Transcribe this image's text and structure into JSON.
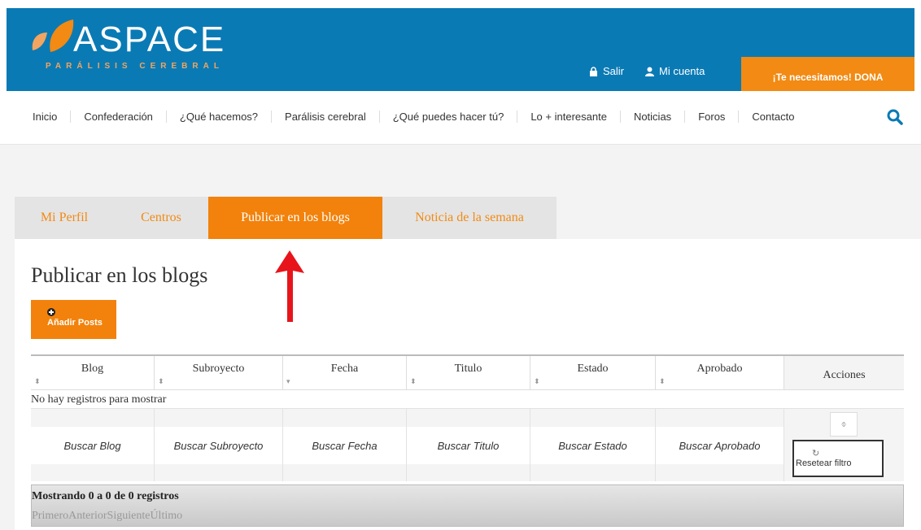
{
  "header": {
    "logo_text": "ASPACE",
    "logo_sub": "PARÁLISIS CEREBRAL",
    "salir_label": "Salir",
    "cuenta_label": "Mi cuenta",
    "donate_label": "¡Te necesitamos! DONA"
  },
  "nav": {
    "items": [
      "Inicio",
      "Confederación",
      "¿Qué hacemos?",
      "Parálisis cerebral",
      "¿Qué puedes hacer tú?",
      "Lo + interesante",
      "Noticias",
      "Foros",
      "Contacto"
    ]
  },
  "tabs": [
    "Mi Perfil",
    "Centros",
    "Publicar en los blogs",
    "Noticia de la semana"
  ],
  "page": {
    "title": "Publicar en los blogs",
    "add_button": "Añadir Posts"
  },
  "table": {
    "columns": [
      "Blog",
      "Subroyecto",
      "Fecha",
      "Titulo",
      "Estado",
      "Aprobado",
      "Acciones"
    ],
    "empty_message": "No hay registros para mostrar",
    "filters": [
      "Buscar Blog",
      "Buscar Subroyecto",
      "Buscar Fecha",
      "Buscar Titulo",
      "Buscar Estado",
      "Buscar Aprobado"
    ],
    "reset_label": "Resetear filtro",
    "showing": "Mostrando 0 a 0 de 0 registros",
    "pager": [
      "Primero",
      "Anterior",
      "Siguiente",
      "Último"
    ]
  },
  "colors": {
    "header_blue": "#0a7ab5",
    "accent_orange": "#f2820b",
    "arrow_red": "#e8141b"
  }
}
